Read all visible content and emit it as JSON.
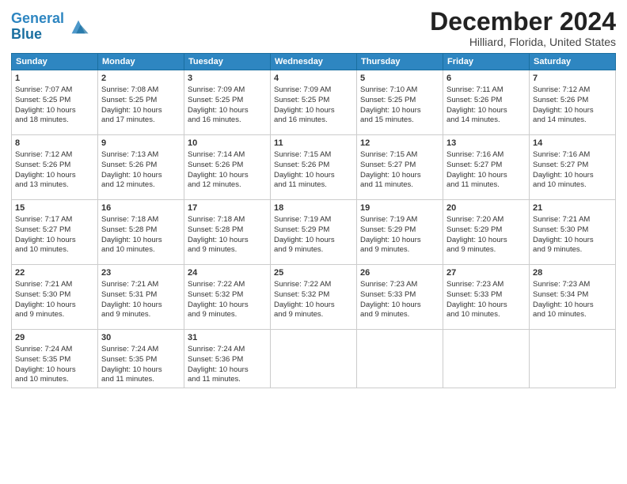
{
  "header": {
    "logo_line1": "General",
    "logo_line2": "Blue",
    "month": "December 2024",
    "location": "Hilliard, Florida, United States"
  },
  "days_of_week": [
    "Sunday",
    "Monday",
    "Tuesday",
    "Wednesday",
    "Thursday",
    "Friday",
    "Saturday"
  ],
  "weeks": [
    [
      {
        "day": 1,
        "lines": [
          "Sunrise: 7:07 AM",
          "Sunset: 5:25 PM",
          "Daylight: 10 hours",
          "and 18 minutes."
        ]
      },
      {
        "day": 2,
        "lines": [
          "Sunrise: 7:08 AM",
          "Sunset: 5:25 PM",
          "Daylight: 10 hours",
          "and 17 minutes."
        ]
      },
      {
        "day": 3,
        "lines": [
          "Sunrise: 7:09 AM",
          "Sunset: 5:25 PM",
          "Daylight: 10 hours",
          "and 16 minutes."
        ]
      },
      {
        "day": 4,
        "lines": [
          "Sunrise: 7:09 AM",
          "Sunset: 5:25 PM",
          "Daylight: 10 hours",
          "and 16 minutes."
        ]
      },
      {
        "day": 5,
        "lines": [
          "Sunrise: 7:10 AM",
          "Sunset: 5:25 PM",
          "Daylight: 10 hours",
          "and 15 minutes."
        ]
      },
      {
        "day": 6,
        "lines": [
          "Sunrise: 7:11 AM",
          "Sunset: 5:26 PM",
          "Daylight: 10 hours",
          "and 14 minutes."
        ]
      },
      {
        "day": 7,
        "lines": [
          "Sunrise: 7:12 AM",
          "Sunset: 5:26 PM",
          "Daylight: 10 hours",
          "and 14 minutes."
        ]
      }
    ],
    [
      {
        "day": 8,
        "lines": [
          "Sunrise: 7:12 AM",
          "Sunset: 5:26 PM",
          "Daylight: 10 hours",
          "and 13 minutes."
        ]
      },
      {
        "day": 9,
        "lines": [
          "Sunrise: 7:13 AM",
          "Sunset: 5:26 PM",
          "Daylight: 10 hours",
          "and 12 minutes."
        ]
      },
      {
        "day": 10,
        "lines": [
          "Sunrise: 7:14 AM",
          "Sunset: 5:26 PM",
          "Daylight: 10 hours",
          "and 12 minutes."
        ]
      },
      {
        "day": 11,
        "lines": [
          "Sunrise: 7:15 AM",
          "Sunset: 5:26 PM",
          "Daylight: 10 hours",
          "and 11 minutes."
        ]
      },
      {
        "day": 12,
        "lines": [
          "Sunrise: 7:15 AM",
          "Sunset: 5:27 PM",
          "Daylight: 10 hours",
          "and 11 minutes."
        ]
      },
      {
        "day": 13,
        "lines": [
          "Sunrise: 7:16 AM",
          "Sunset: 5:27 PM",
          "Daylight: 10 hours",
          "and 11 minutes."
        ]
      },
      {
        "day": 14,
        "lines": [
          "Sunrise: 7:16 AM",
          "Sunset: 5:27 PM",
          "Daylight: 10 hours",
          "and 10 minutes."
        ]
      }
    ],
    [
      {
        "day": 15,
        "lines": [
          "Sunrise: 7:17 AM",
          "Sunset: 5:27 PM",
          "Daylight: 10 hours",
          "and 10 minutes."
        ]
      },
      {
        "day": 16,
        "lines": [
          "Sunrise: 7:18 AM",
          "Sunset: 5:28 PM",
          "Daylight: 10 hours",
          "and 10 minutes."
        ]
      },
      {
        "day": 17,
        "lines": [
          "Sunrise: 7:18 AM",
          "Sunset: 5:28 PM",
          "Daylight: 10 hours",
          "and 9 minutes."
        ]
      },
      {
        "day": 18,
        "lines": [
          "Sunrise: 7:19 AM",
          "Sunset: 5:29 PM",
          "Daylight: 10 hours",
          "and 9 minutes."
        ]
      },
      {
        "day": 19,
        "lines": [
          "Sunrise: 7:19 AM",
          "Sunset: 5:29 PM",
          "Daylight: 10 hours",
          "and 9 minutes."
        ]
      },
      {
        "day": 20,
        "lines": [
          "Sunrise: 7:20 AM",
          "Sunset: 5:29 PM",
          "Daylight: 10 hours",
          "and 9 minutes."
        ]
      },
      {
        "day": 21,
        "lines": [
          "Sunrise: 7:21 AM",
          "Sunset: 5:30 PM",
          "Daylight: 10 hours",
          "and 9 minutes."
        ]
      }
    ],
    [
      {
        "day": 22,
        "lines": [
          "Sunrise: 7:21 AM",
          "Sunset: 5:30 PM",
          "Daylight: 10 hours",
          "and 9 minutes."
        ]
      },
      {
        "day": 23,
        "lines": [
          "Sunrise: 7:21 AM",
          "Sunset: 5:31 PM",
          "Daylight: 10 hours",
          "and 9 minutes."
        ]
      },
      {
        "day": 24,
        "lines": [
          "Sunrise: 7:22 AM",
          "Sunset: 5:32 PM",
          "Daylight: 10 hours",
          "and 9 minutes."
        ]
      },
      {
        "day": 25,
        "lines": [
          "Sunrise: 7:22 AM",
          "Sunset: 5:32 PM",
          "Daylight: 10 hours",
          "and 9 minutes."
        ]
      },
      {
        "day": 26,
        "lines": [
          "Sunrise: 7:23 AM",
          "Sunset: 5:33 PM",
          "Daylight: 10 hours",
          "and 9 minutes."
        ]
      },
      {
        "day": 27,
        "lines": [
          "Sunrise: 7:23 AM",
          "Sunset: 5:33 PM",
          "Daylight: 10 hours",
          "and 10 minutes."
        ]
      },
      {
        "day": 28,
        "lines": [
          "Sunrise: 7:23 AM",
          "Sunset: 5:34 PM",
          "Daylight: 10 hours",
          "and 10 minutes."
        ]
      }
    ],
    [
      {
        "day": 29,
        "lines": [
          "Sunrise: 7:24 AM",
          "Sunset: 5:35 PM",
          "Daylight: 10 hours",
          "and 10 minutes."
        ]
      },
      {
        "day": 30,
        "lines": [
          "Sunrise: 7:24 AM",
          "Sunset: 5:35 PM",
          "Daylight: 10 hours",
          "and 11 minutes."
        ]
      },
      {
        "day": 31,
        "lines": [
          "Sunrise: 7:24 AM",
          "Sunset: 5:36 PM",
          "Daylight: 10 hours",
          "and 11 minutes."
        ]
      },
      null,
      null,
      null,
      null
    ]
  ]
}
